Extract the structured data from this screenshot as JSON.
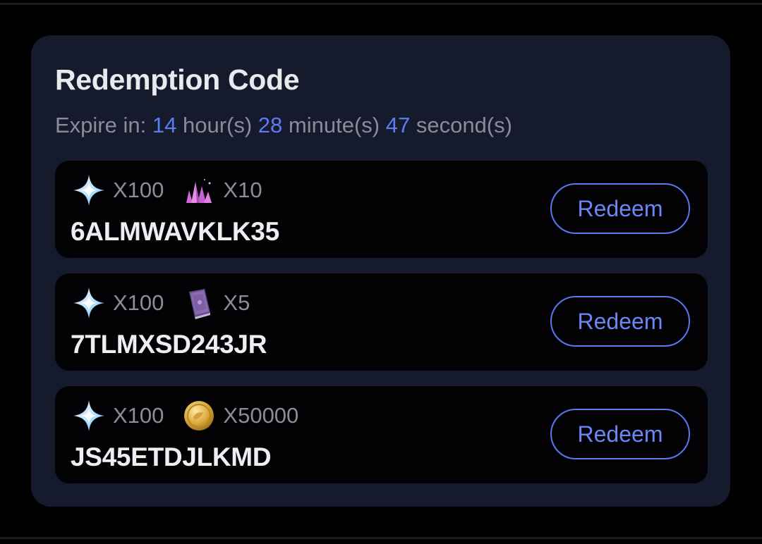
{
  "panel": {
    "title": "Redemption Code",
    "expire": {
      "label": "Expire in:",
      "hours": "14",
      "hours_unit": "hour(s)",
      "minutes": "28",
      "minutes_unit": "minute(s)",
      "seconds": "47",
      "seconds_unit": "second(s)"
    }
  },
  "codes": [
    {
      "rewards": [
        {
          "icon": "star-gem-icon",
          "qty": "X100"
        },
        {
          "icon": "crystal-cluster-icon",
          "qty": "X10"
        }
      ],
      "code": "6ALMWAVKLK35",
      "button_label": "Redeem"
    },
    {
      "rewards": [
        {
          "icon": "star-gem-icon",
          "qty": "X100"
        },
        {
          "icon": "book-icon",
          "qty": "X5"
        }
      ],
      "code": "7TLMXSD243JR",
      "button_label": "Redeem"
    },
    {
      "rewards": [
        {
          "icon": "star-gem-icon",
          "qty": "X100"
        },
        {
          "icon": "gold-coin-icon",
          "qty": "X50000"
        }
      ],
      "code": "JS45ETDJLKMD",
      "button_label": "Redeem"
    }
  ],
  "colors": {
    "background": "#000000",
    "card": "#151a2c",
    "row": "#020204",
    "accent": "#5c7cf0",
    "title_text": "#e9e9ee",
    "muted_text": "#8a8d99"
  }
}
